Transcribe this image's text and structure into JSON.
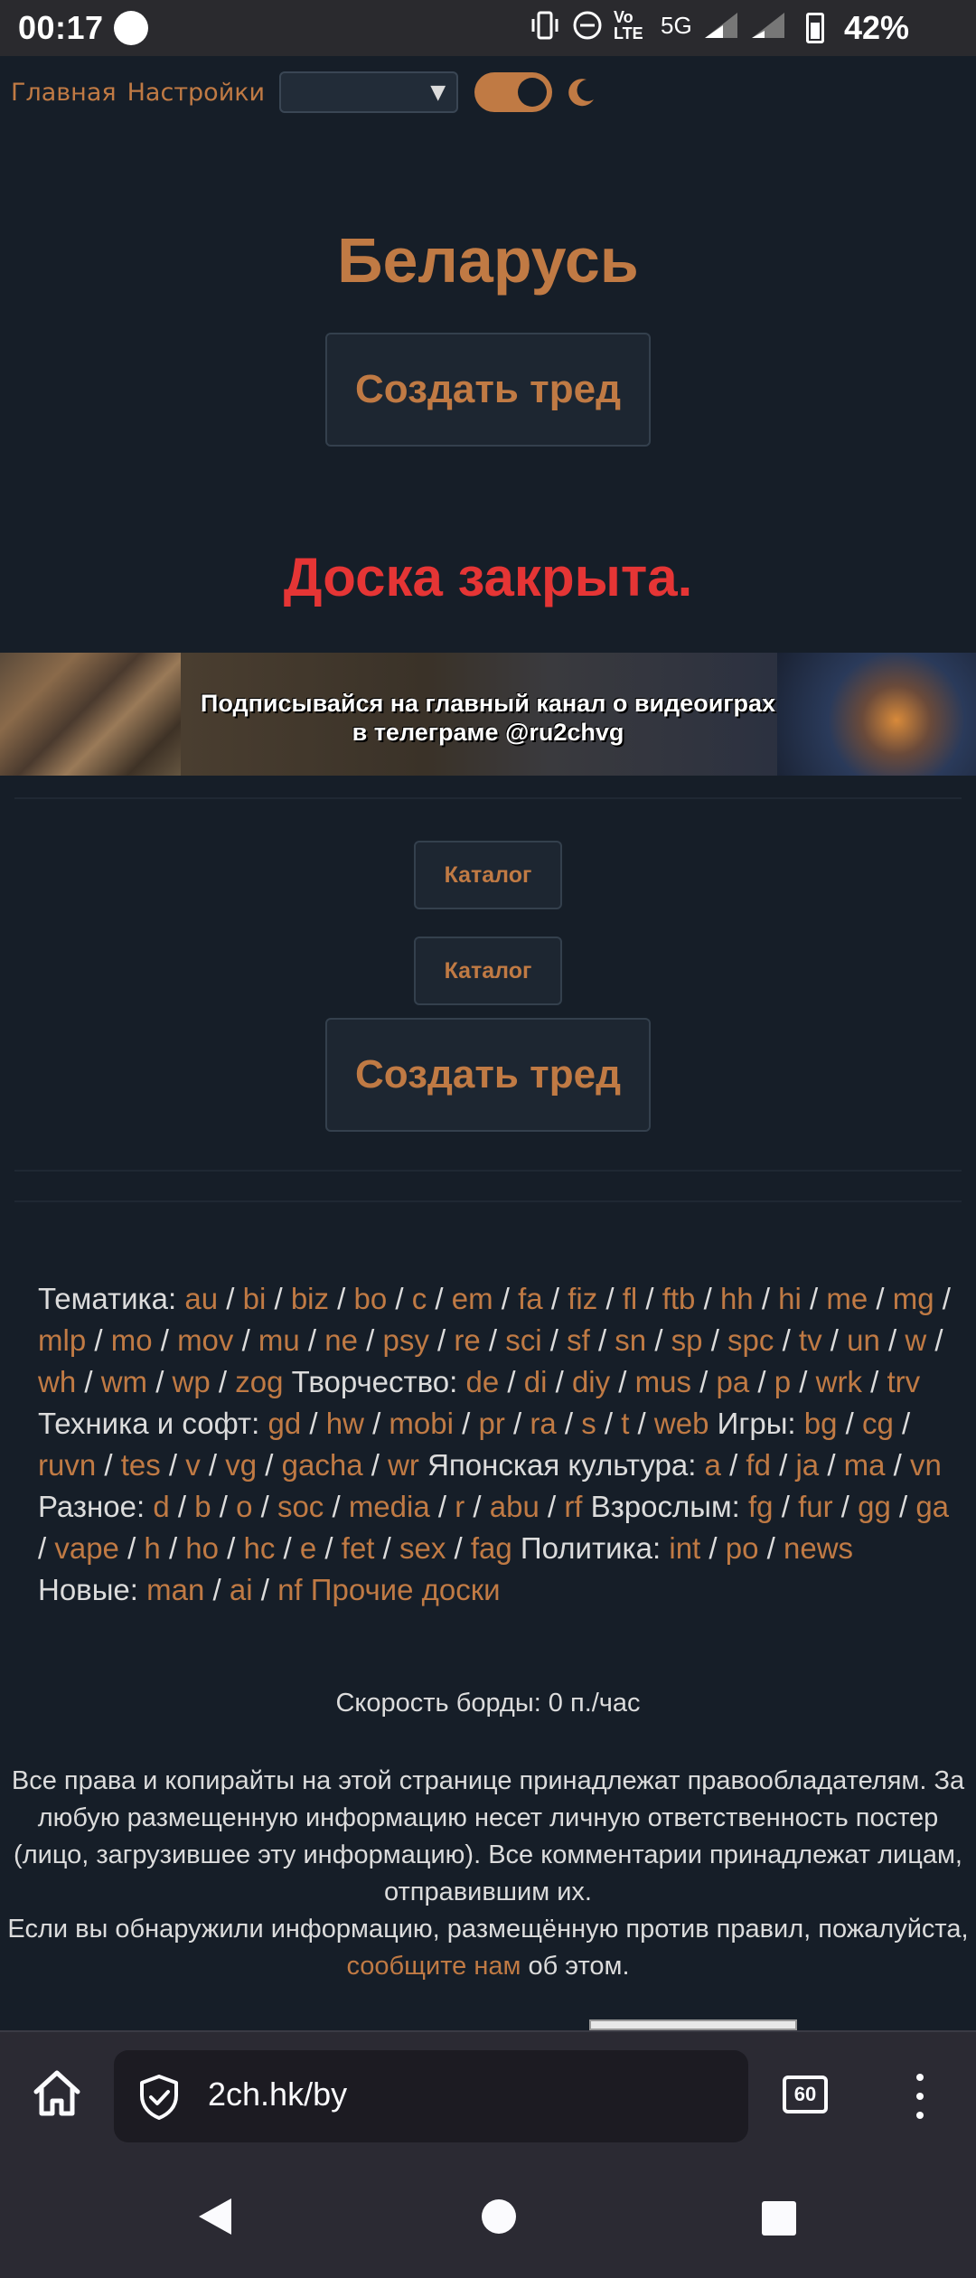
{
  "status_bar": {
    "time": "00:17",
    "network": "5G",
    "volte": "Vo LTE",
    "battery": "42%"
  },
  "top_nav": {
    "home_link": "Главная",
    "settings_link": "Настройки",
    "style_select_value": "",
    "dark_mode_on": true
  },
  "board": {
    "title": "Беларусь",
    "create_thread": "Создать тред",
    "closed_notice": "Доска закрыта."
  },
  "banner": {
    "line1": "Подписывайся на главный канал о видеоиграх",
    "line2": "в телеграме @ru2chvg"
  },
  "catalog_buttons": [
    "Каталог",
    "Каталог"
  ],
  "create_thread_bottom": "Создать тред",
  "board_list": [
    {
      "label": "Тематика:",
      "boards": [
        "au",
        "bi",
        "biz",
        "bo",
        "c",
        "em",
        "fa",
        "fiz",
        "fl",
        "ftb",
        "hh",
        "hi",
        "me",
        "mg",
        "mlp",
        "mo",
        "mov",
        "mu",
        "ne",
        "psy",
        "re",
        "sci",
        "sf",
        "sn",
        "sp",
        "spc",
        "tv",
        "un",
        "w",
        "wh",
        "wm",
        "wp",
        "zog"
      ]
    },
    {
      "label": "Творчество:",
      "boards": [
        "de",
        "di",
        "diy",
        "mus",
        "pa",
        "p",
        "wrk",
        "trv"
      ]
    },
    {
      "label": "Техника и софт:",
      "boards": [
        "gd",
        "hw",
        "mobi",
        "pr",
        "ra",
        "s",
        "t",
        "web"
      ]
    },
    {
      "label": "Игры:",
      "boards": [
        "bg",
        "cg",
        "ruvn",
        "tes",
        "v",
        "vg",
        "gacha",
        "wr"
      ]
    },
    {
      "label": "Японская культура:",
      "boards": [
        "a",
        "fd",
        "ja",
        "ma",
        "vn"
      ]
    },
    {
      "label": "Разное:",
      "boards": [
        "d",
        "b",
        "o",
        "soc",
        "media",
        "r",
        "abu",
        "rf"
      ]
    },
    {
      "label": "Взрослым:",
      "boards": [
        "fg",
        "fur",
        "gg",
        "ga",
        "vape",
        "h",
        "ho",
        "hc",
        "e",
        "fet",
        "sex",
        "fag"
      ]
    },
    {
      "label": "Политика:",
      "boards": [
        "int",
        "po",
        "news"
      ]
    },
    {
      "label": "Новые:",
      "boards": [
        "man",
        "ai",
        "nf"
      ]
    }
  ],
  "other_boards_link": "Прочие доски",
  "speed_text": "Скорость борды: 0 п./час",
  "footer": {
    "text": "Все права и копирайты на этой странице принадлежат правообладателям. За любую размещенную информацию несет личную ответственность постер (лицо, загрузившее эту информацию). Все комментарии принадлежат лицам, отправившим их.",
    "report_prefix": "Если вы обнаружили информацию, размещённую против правил, пожалуйста,",
    "report_link": "сообщите нам",
    "report_suffix": "об этом."
  },
  "browser": {
    "url": "2ch.hk/by",
    "tab_count": "60"
  },
  "colors": {
    "background": "#161e28",
    "accent": "#c07a44",
    "closed": "#e53535",
    "text": "#dcdcdc"
  }
}
